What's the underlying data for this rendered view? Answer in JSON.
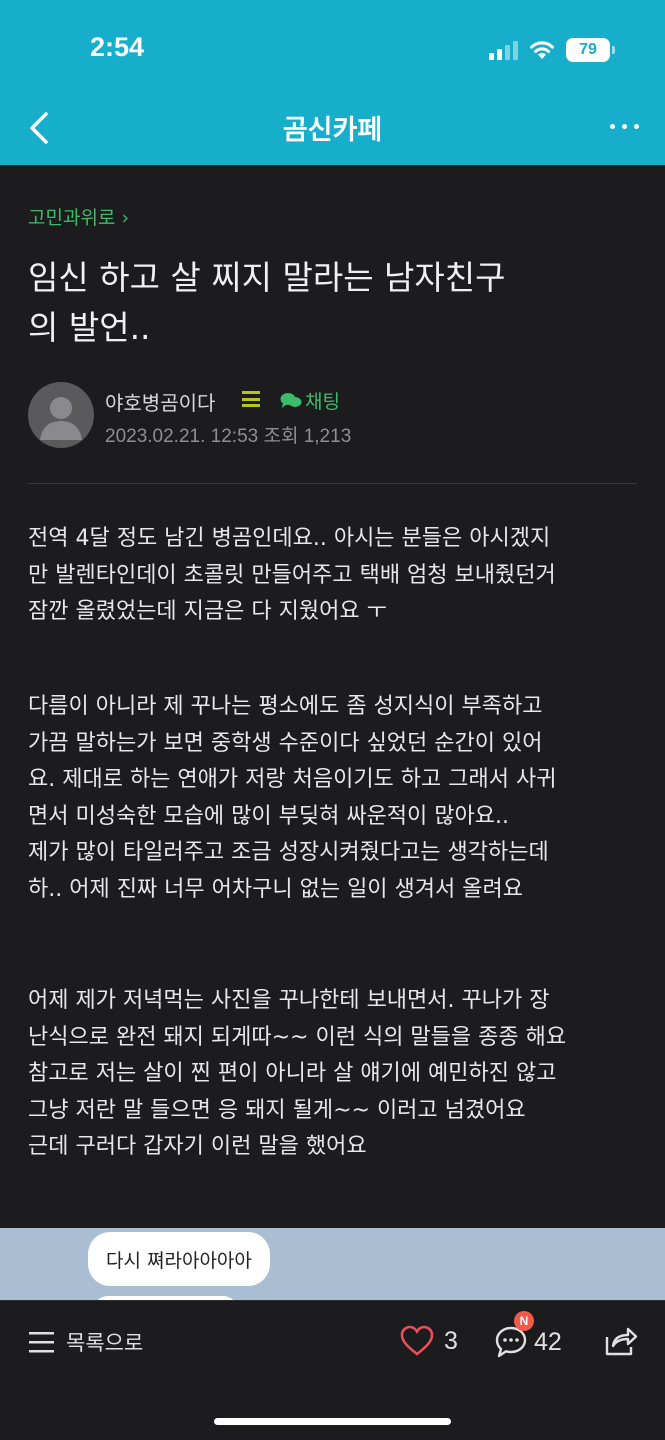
{
  "status_bar": {
    "time": "2:54",
    "battery": "79"
  },
  "nav": {
    "title": "곰신카페"
  },
  "post": {
    "board": "고민과위로 ›",
    "title": "임신 하고 살 찌지 말라는 남자친구의 발언..",
    "title_lines": [
      "임신 하고 살 찌지 말라는 남자친구",
      "의 발언.."
    ],
    "author": "야호병곰이다",
    "chat_label": "채팅",
    "meta": "2023.02.21. 12:53  조회 1,213",
    "paragraphs": [
      [
        "전역 4달 정도 남긴 병곰인데요.. 아시는 분들은 아시겠지",
        "만 발렌타인데이 초콜릿 만들어주고 택배 엄청 보내줬던거",
        "잠깐 올렸었는데 지금은 다 지웠어요 ㅜ"
      ],
      [
        "다름이 아니라 제 꾸나는 평소에도 좀 성지식이 부족하고",
        "가끔 말하는가 보면 중학생 수준이다 싶었던 순간이 있어",
        "요. 제대로 하는 연애가 저랑 처음이기도 하고 그래서 사귀",
        "면서 미성숙한 모습에 많이 부딪혀 싸운적이 많아요..",
        "제가 많이 타일러주고 조금 성장시켜줬다고는 생각하는데",
        "하.. 어제 진짜 너무 어차구니 없는 일이 생겨서 올려요"
      ],
      [
        "어제 제가 저녁먹는 사진을 꾸나한테 보내면서. 꾸나가 장",
        "난식으로 완전 돼지 되게따~~ 이런 식의 말들을 종종 해요",
        "참고로 저는 살이 찐 편이 아니라 살 얘기에 예민하진 않고",
        "그냥 저란 말 들으면 응 돼지 될게~~ 이러고 넘겼어요",
        "근데 구러다 갑자기 이런 말을 했어요"
      ]
    ],
    "image_chat_bubble": "다시 쪄라아아아아"
  },
  "bottom_bar": {
    "list_label": "목록으로",
    "likes": "3",
    "comments": "42",
    "new_badge": "N"
  },
  "colors": {
    "accent": "#17aecb",
    "green": "#3dbb6a",
    "background": "#1c1c1e",
    "heart": "#e8505b",
    "badge": "#f15a4a"
  }
}
